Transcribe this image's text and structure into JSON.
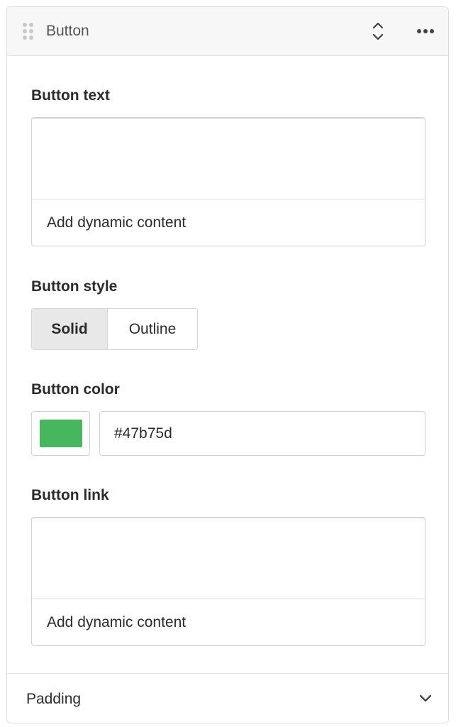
{
  "header": {
    "title": "Button"
  },
  "button_text": {
    "label": "Button text",
    "dynamic_label": "Add dynamic content"
  },
  "button_style": {
    "label": "Button style",
    "options": [
      "Solid",
      "Outline"
    ],
    "selected": "Solid"
  },
  "button_color": {
    "label": "Button color",
    "value": "#47b75d",
    "swatch": "#47b75d"
  },
  "button_link": {
    "label": "Button link",
    "dynamic_label": "Add dynamic content"
  },
  "padding": {
    "label": "Padding"
  },
  "icons": {
    "drag": "drag-handle-icon",
    "collapse": "collapse-expand-icon",
    "more": "more-horizontal-icon",
    "chevron": "chevron-down-icon"
  }
}
